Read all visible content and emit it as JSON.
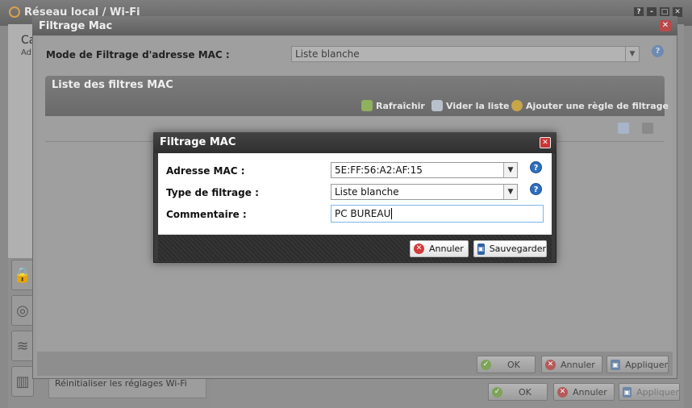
{
  "background_window": {
    "title": "Réseau local / Wi-Fi",
    "controls": [
      "?",
      "-",
      "□",
      "✕"
    ],
    "partial_heading": "Ca",
    "partial_sub": "Ad",
    "reset_label": "Réinitialiser les réglages Wi-Fi",
    "footer": {
      "ok": "OK",
      "cancel": "Annuler",
      "apply": "Appliquer"
    }
  },
  "mac_dialog": {
    "title": "Filtrage Mac",
    "mode_label": "Mode de Filtrage d'adresse MAC :",
    "mode_value": "Liste blanche",
    "list_title": "Liste des filtres MAC",
    "actions": {
      "refresh": "Rafraîchir",
      "clear": "Vider la liste",
      "add": "Ajouter une règle de filtrage"
    },
    "footer": {
      "ok": "OK",
      "cancel": "Annuler",
      "apply": "Appliquer"
    }
  },
  "modal": {
    "title": "Filtrage MAC",
    "fields": {
      "mac_label": "Adresse MAC :",
      "mac_value": "5E:FF:56:A2:AF:15",
      "type_label": "Type de filtrage :",
      "type_value": "Liste blanche",
      "comment_label": "Commentaire :",
      "comment_value": "PC BUREAU"
    },
    "buttons": {
      "cancel": "Annuler",
      "save": "Sauvegarder"
    }
  },
  "colors": {
    "help_blue": "#2f6fc0",
    "close_red": "#c93535",
    "input_focus": "#7eb4ea"
  }
}
